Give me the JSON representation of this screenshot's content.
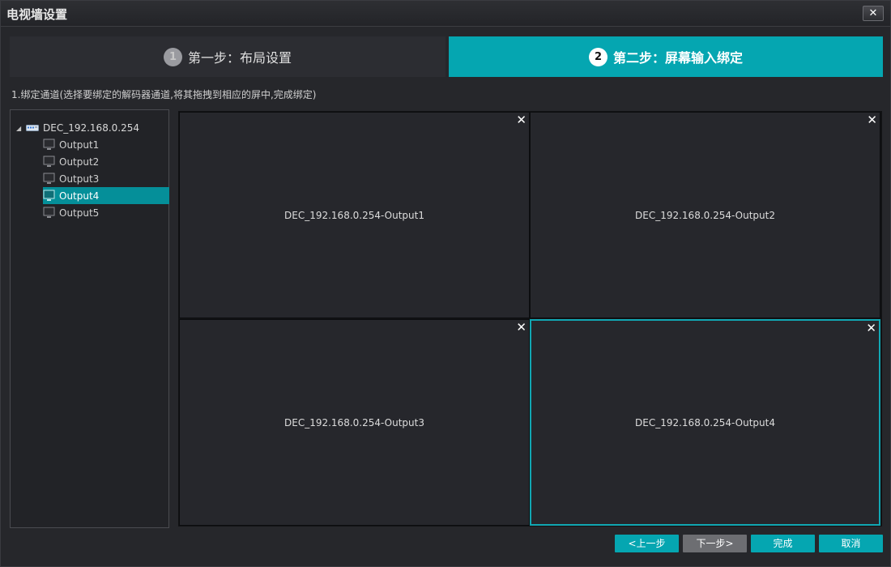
{
  "window": {
    "title": "电视墙设置",
    "close_label": "✕"
  },
  "steps": [
    {
      "number": "1",
      "label": "第一步：布局设置",
      "active": false
    },
    {
      "number": "2",
      "label": "第二步：屏幕输入绑定",
      "active": true
    }
  ],
  "instruction": "1.绑定通道(选择要绑定的解码器通道,将其拖拽到相应的屏中,完成绑定)",
  "tree": {
    "root": {
      "label": "DEC_192.168.0.254",
      "icon": "decoder-device-icon",
      "expanded": true
    },
    "children": [
      {
        "label": "Output1",
        "icon": "monitor-icon",
        "selected": false
      },
      {
        "label": "Output2",
        "icon": "monitor-icon",
        "selected": false
      },
      {
        "label": "Output3",
        "icon": "monitor-icon",
        "selected": false
      },
      {
        "label": "Output4",
        "icon": "monitor-icon",
        "selected": true
      },
      {
        "label": "Output5",
        "icon": "monitor-icon",
        "selected": false
      }
    ]
  },
  "screens": [
    {
      "label": "DEC_192.168.0.254-Output1",
      "close": "✕",
      "active": false
    },
    {
      "label": "DEC_192.168.0.254-Output2",
      "close": "✕",
      "active": false
    },
    {
      "label": "DEC_192.168.0.254-Output3",
      "close": "✕",
      "active": false
    },
    {
      "label": "DEC_192.168.0.254-Output4",
      "close": "✕",
      "active": true
    }
  ],
  "buttons": {
    "prev": "<上一步",
    "next": "下一步>",
    "finish": "完成",
    "cancel": "取消"
  },
  "colors": {
    "accent": "#05a6b1",
    "selected_row": "#058f99",
    "disabled_button": "#6d6e72"
  }
}
